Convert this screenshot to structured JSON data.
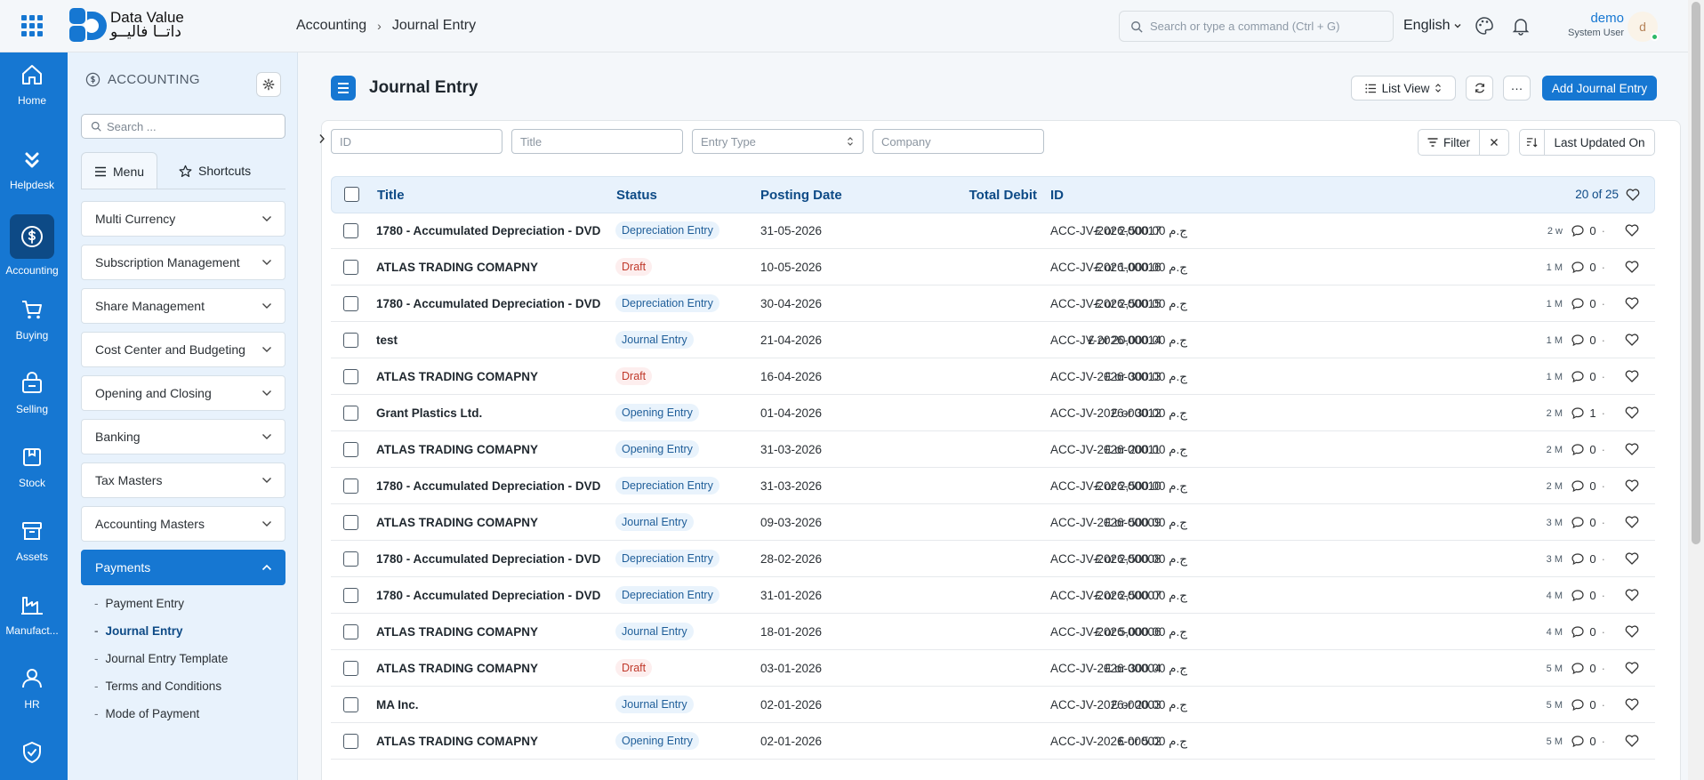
{
  "topbar": {
    "logo_en": "Data Value",
    "logo_ar": "داتــا فاليــو",
    "breadcrumb": [
      "Accounting",
      "Journal Entry"
    ],
    "search_placeholder": "Search or type a command (Ctrl + G)",
    "language": "English",
    "user_name": "demo",
    "user_role": "System User",
    "avatar_letter": "d"
  },
  "rail": [
    {
      "label": "Home",
      "icon": "home-icon"
    },
    {
      "label": "Helpdesk",
      "icon": "chevrons-down-icon"
    },
    {
      "label": "Accounting",
      "icon": "dollar-icon"
    },
    {
      "label": "Buying",
      "icon": "cart-icon"
    },
    {
      "label": "Selling",
      "icon": "shop-icon"
    },
    {
      "label": "Stock",
      "icon": "box-icon"
    },
    {
      "label": "Assets",
      "icon": "archive-icon"
    },
    {
      "label": "Manufact...",
      "icon": "factory-icon"
    },
    {
      "label": "HR",
      "icon": "users-icon"
    },
    {
      "label": "",
      "icon": "shield-check-icon"
    }
  ],
  "side": {
    "title": "ACCOUNTING",
    "search_placeholder": "Search ...",
    "tab_menu": "Menu",
    "tab_shortcuts": "Shortcuts",
    "groups": [
      "Multi Currency",
      "Subscription Management",
      "Share Management",
      "Cost Center and Budgeting",
      "Opening and Closing",
      "Banking",
      "Tax Masters",
      "Accounting Masters",
      "Payments"
    ],
    "payments_items": [
      "Payment Entry",
      "Journal Entry",
      "Journal Entry Template",
      "Terms and Conditions",
      "Mode of Payment"
    ]
  },
  "page": {
    "title": "Journal Entry",
    "list_view": "List View",
    "more": "···",
    "add_button": "Add Journal Entry"
  },
  "filters": {
    "id_placeholder": "ID",
    "title_placeholder": "Title",
    "entry_type_placeholder": "Entry Type",
    "company_placeholder": "Company",
    "filter_label": "Filter",
    "sort_label": "Last Updated On"
  },
  "table": {
    "headers": {
      "title": "Title",
      "status": "Status",
      "posting_date": "Posting Date",
      "total_debit": "Total Debit",
      "id": "ID"
    },
    "count": "20 of 25",
    "rows": [
      {
        "title": "1780 - Accumulated Depreciation - DVD",
        "status": "Depreciation Entry",
        "tone": "blue",
        "date": "31-05-2026",
        "debit": "£ or 2,500.00 ج.م",
        "id": "ACC-JV-2026-00017",
        "ago": "2 w",
        "comments": "0"
      },
      {
        "title": "ATLAS TRADING COMAPNY",
        "status": "Draft",
        "tone": "red",
        "date": "10-05-2026",
        "debit": "£ or 1,000.00 ج.م",
        "id": "ACC-JV-2026-00016",
        "ago": "1 M",
        "comments": "0"
      },
      {
        "title": "1780 - Accumulated Depreciation - DVD",
        "status": "Depreciation Entry",
        "tone": "blue",
        "date": "30-04-2026",
        "debit": "£ or 2,500.00 ج.م",
        "id": "ACC-JV-2026-00015",
        "ago": "1 M",
        "comments": "0"
      },
      {
        "title": "test",
        "status": "Journal Entry",
        "tone": "blue",
        "date": "21-04-2026",
        "debit": "£ or 20,000.00 ج.م",
        "id": "ACC-JV-2026-00014",
        "ago": "1 M",
        "comments": "0"
      },
      {
        "title": "ATLAS TRADING COMAPNY",
        "status": "Draft",
        "tone": "red",
        "date": "16-04-2026",
        "debit": "£ or 300.00 ج.م",
        "id": "ACC-JV-2026-00013",
        "ago": "1 M",
        "comments": "0"
      },
      {
        "title": "Grant Plastics Ltd.",
        "status": "Opening Entry",
        "tone": "blue",
        "date": "01-04-2026",
        "debit": "£ or 30.00 ج.م",
        "id": "ACC-JV-2026-00012",
        "ago": "2 M",
        "comments": "1"
      },
      {
        "title": "ATLAS TRADING COMAPNY",
        "status": "Opening Entry",
        "tone": "blue",
        "date": "31-03-2026",
        "debit": "£ or 200.00 ج.م",
        "id": "ACC-JV-2026-00011",
        "ago": "2 M",
        "comments": "0"
      },
      {
        "title": "1780 - Accumulated Depreciation - DVD",
        "status": "Depreciation Entry",
        "tone": "blue",
        "date": "31-03-2026",
        "debit": "£ or 2,500.00 ج.م",
        "id": "ACC-JV-2026-00010",
        "ago": "2 M",
        "comments": "0"
      },
      {
        "title": "ATLAS TRADING COMAPNY",
        "status": "Journal Entry",
        "tone": "blue",
        "date": "09-03-2026",
        "debit": "£ or 500.00 ج.م",
        "id": "ACC-JV-2026-00009",
        "ago": "3 M",
        "comments": "0"
      },
      {
        "title": "1780 - Accumulated Depreciation - DVD",
        "status": "Depreciation Entry",
        "tone": "blue",
        "date": "28-02-2026",
        "debit": "£ or 2,500.00 ج.م",
        "id": "ACC-JV-2026-00008",
        "ago": "3 M",
        "comments": "0"
      },
      {
        "title": "1780 - Accumulated Depreciation - DVD",
        "status": "Depreciation Entry",
        "tone": "blue",
        "date": "31-01-2026",
        "debit": "£ or 2,500.00 ج.م",
        "id": "ACC-JV-2026-00007",
        "ago": "4 M",
        "comments": "0"
      },
      {
        "title": "ATLAS TRADING COMAPNY",
        "status": "Journal Entry",
        "tone": "blue",
        "date": "18-01-2026",
        "debit": "£ or 5,000.00 ج.م",
        "id": "ACC-JV-2026-00006",
        "ago": "4 M",
        "comments": "0"
      },
      {
        "title": "ATLAS TRADING COMAPNY",
        "status": "Draft",
        "tone": "red",
        "date": "03-01-2026",
        "debit": "£ or 300.00 ج.م",
        "id": "ACC-JV-2026-00004",
        "ago": "5 M",
        "comments": "0"
      },
      {
        "title": "MA Inc.",
        "status": "Journal Entry",
        "tone": "blue",
        "date": "02-01-2026",
        "debit": "£ or 20.00 ج.م",
        "id": "ACC-JV-2026-00003",
        "ago": "5 M",
        "comments": "0"
      },
      {
        "title": "ATLAS TRADING COMAPNY",
        "status": "Opening Entry",
        "tone": "blue",
        "date": "02-01-2026",
        "debit": "£ or 5.00 ج.م",
        "id": "ACC-JV-2026-00002",
        "ago": "5 M",
        "comments": "0"
      }
    ]
  },
  "colors": {
    "accent": "#1677d2",
    "accent_dark": "#0d4a86",
    "draft": "#c0392b"
  }
}
